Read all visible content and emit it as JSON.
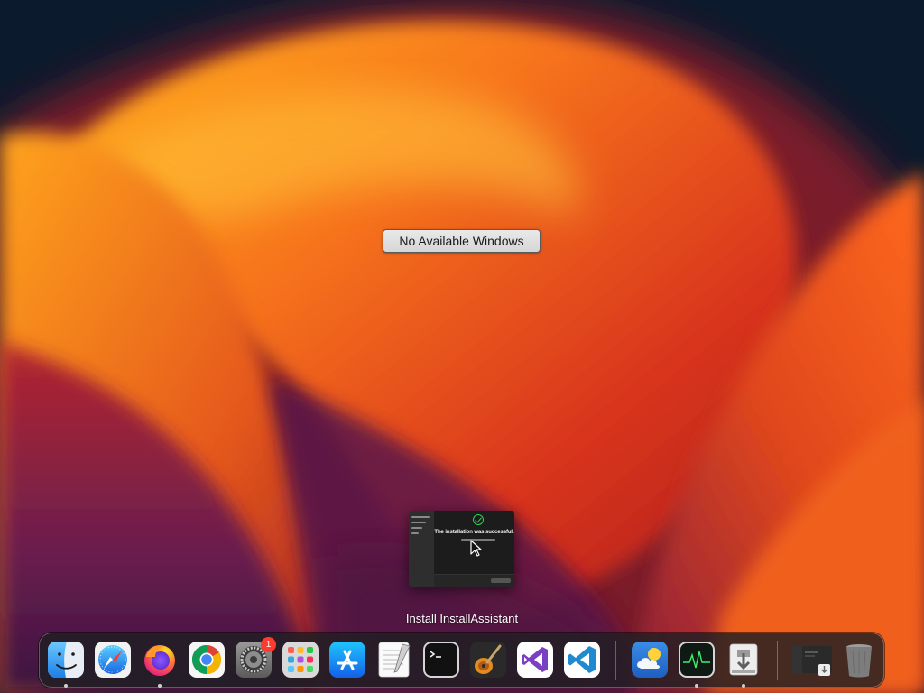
{
  "desktop": {
    "no_windows_label": "No Available Windows",
    "window_title": "Install InstallAssistant",
    "thumbnail": {
      "message": "The installation was successful."
    }
  },
  "dock": {
    "items": [
      {
        "name": "Finder",
        "running": true
      },
      {
        "name": "Safari",
        "running": false
      },
      {
        "name": "Firefox",
        "running": true
      },
      {
        "name": "Google Chrome",
        "running": false
      },
      {
        "name": "System Settings",
        "running": false,
        "badge": "1"
      },
      {
        "name": "Launchpad",
        "running": false
      },
      {
        "name": "App Store",
        "running": false
      },
      {
        "name": "TextEdit",
        "running": false
      },
      {
        "name": "Terminal",
        "running": false
      },
      {
        "name": "GarageBand",
        "running": false
      },
      {
        "name": "Visual Studio",
        "running": false
      },
      {
        "name": "Visual Studio Code",
        "running": false
      },
      {
        "name": "Weather",
        "running": false
      },
      {
        "name": "Activity Monitor",
        "running": true
      },
      {
        "name": "Installer",
        "running": true
      },
      {
        "name": "Minimized window",
        "running": false
      },
      {
        "name": "Trash",
        "running": false
      }
    ]
  },
  "colors": {
    "wallpaper_orange": "#f7931e",
    "wallpaper_red": "#d6321e",
    "wallpaper_navy": "#0b1a2c",
    "wallpaper_purple": "#6a1e4e",
    "badge_red": "#ff3b30",
    "success_green": "#2ed158"
  }
}
